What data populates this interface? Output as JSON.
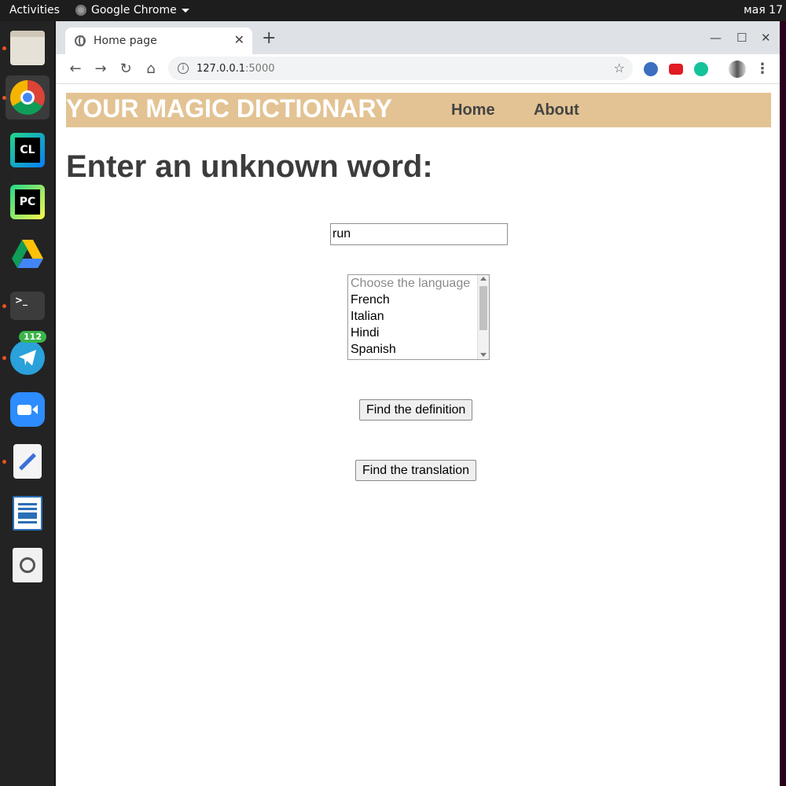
{
  "system": {
    "activities_label": "Activities",
    "app_name": "Google Chrome",
    "clock": "мая 17"
  },
  "dock": {
    "items": [
      {
        "name": "files-icon"
      },
      {
        "name": "chrome-icon"
      },
      {
        "name": "clion-icon",
        "text": "CL"
      },
      {
        "name": "pycharm-icon",
        "text": "PC"
      },
      {
        "name": "google-drive-icon"
      },
      {
        "name": "terminal-icon",
        "text": ">_"
      },
      {
        "name": "telegram-icon",
        "badge": "112"
      },
      {
        "name": "zoom-icon"
      },
      {
        "name": "text-editor-icon"
      },
      {
        "name": "libreoffice-writer-icon"
      },
      {
        "name": "image-viewer-icon"
      }
    ]
  },
  "browser": {
    "tab_title": "Home page",
    "url_host": "127.0.0.1",
    "url_port": ":5000"
  },
  "page": {
    "logo": "YOUR MAGIC DICTIONARY",
    "nav_home": "Home",
    "nav_about": "About",
    "heading": "Enter an unknown word:",
    "word_value": "run",
    "language_placeholder": "Choose the language",
    "languages": [
      "French",
      "Italian",
      "Hindi",
      "Spanish"
    ],
    "definition_button": "Find the definition",
    "translation_button": "Find the translation"
  },
  "colors": {
    "header_bg": "#e3c393",
    "accent": "#e95420"
  }
}
